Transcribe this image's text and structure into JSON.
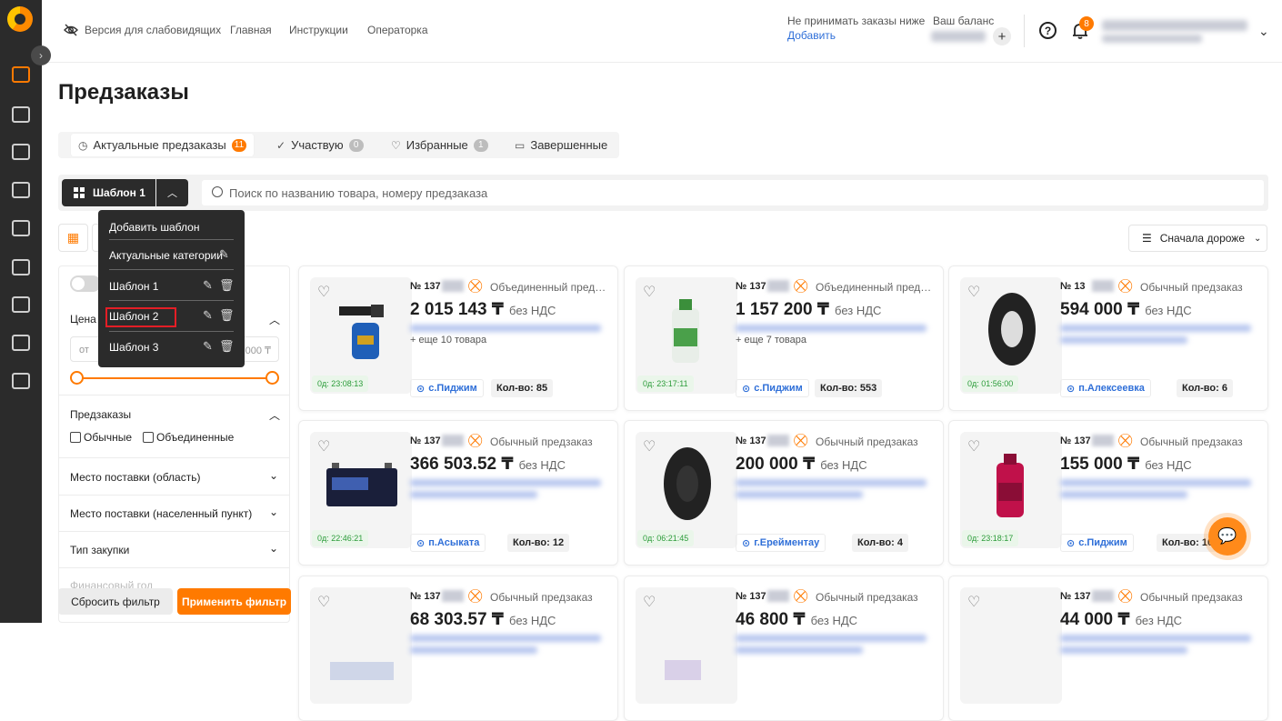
{
  "topbar": {
    "links": [
      "Версия для слабовидящих",
      "Главная",
      "Инструкции",
      "Операторка"
    ],
    "no_orders_label": "Не принимать заказы ниже",
    "add_link": "Добавить",
    "balance_label": "Ваш баланс",
    "notifications_count": "8"
  },
  "page": {
    "title": "Предзаказы"
  },
  "tabs": [
    {
      "label": "Актуальные предзаказы",
      "count": "11"
    },
    {
      "label": "Участвую",
      "count": "0"
    },
    {
      "label": "Избранные",
      "count": "1"
    },
    {
      "label": "Завершенные"
    }
  ],
  "template": {
    "selected": "Шаблон 1"
  },
  "search": {
    "placeholder": "Поиск по названию товара, номеру предзаказа"
  },
  "template_menu": {
    "add": "Добавить шаблон",
    "actual_categories": "Актуальные категории",
    "items": [
      "Шаблон 1",
      "Шаблон 2",
      "Шаблон 3"
    ]
  },
  "sort": {
    "label": "Сначала дороже"
  },
  "filters": {
    "price_label": "Цена",
    "price_from_placeholder": "от",
    "price_to_suffix": "000 ₸",
    "preorders_label": "Предзаказы",
    "option_regular": "Обычные",
    "option_combined": "Объединенные",
    "region_label": "Место поставки (область)",
    "city_label": "Место поставки (населенный пункт)",
    "purchase_type_label": "Тип закупки",
    "fiscal_year_label": "Финансовый год",
    "reset": "Сбросить фильтр",
    "apply": "Применить фильтр"
  },
  "cards": [
    {
      "num": "№ 137",
      "type": "Объединенный предзаказ",
      "price": "2 015 143 ₸",
      "vat": "без НДС",
      "more": "+ еще 10 товара",
      "timer": "0д: 23:08:13",
      "location": "с.Пиджим",
      "qty": "Кол-во: 85"
    },
    {
      "num": "№ 137",
      "type": "Объединенный предзаказ",
      "price": "1 157 200 ₸",
      "vat": "без НДС",
      "more": "+ еще 7 товара",
      "timer": "0д: 23:17:11",
      "location": "с.Пиджим",
      "qty": "Кол-во: 553"
    },
    {
      "num": "№ 13",
      "type": "Обычный предзаказ",
      "price": "594 000 ₸",
      "vat": "без НДС",
      "more": "",
      "timer": "0д: 01:56:00",
      "location": "п.Алексеевка",
      "qty": "Кол-во: 6"
    },
    {
      "num": "№ 137",
      "type": "Обычный предзаказ",
      "price": "366 503.52 ₸",
      "vat": "без НДС",
      "more": "",
      "timer": "0д: 22:46:21",
      "location": "п.Асыката",
      "qty": "Кол-во: 12"
    },
    {
      "num": "№ 137",
      "type": "Обычный предзаказ",
      "price": "200 000 ₸",
      "vat": "без НДС",
      "more": "",
      "timer": "0д: 06:21:45",
      "location": "г.Ерейментау",
      "qty": "Кол-во: 4"
    },
    {
      "num": "№ 137",
      "type": "Обычный предзаказ",
      "price": "155 000 ₸",
      "vat": "без НДС",
      "more": "",
      "timer": "0д: 23:18:17",
      "location": "с.Пиджим",
      "qty": "Кол-во: 10"
    },
    {
      "num": "№ 137",
      "type": "Обычный предзаказ",
      "price": "68 303.57 ₸",
      "vat": "без НДС",
      "more": "",
      "timer": "",
      "location": "",
      "qty": ""
    },
    {
      "num": "№ 137",
      "type": "Обычный предзаказ",
      "price": "46 800 ₸",
      "vat": "без НДС",
      "more": "",
      "timer": "",
      "location": "",
      "qty": ""
    },
    {
      "num": "№ 137",
      "type": "Обычный предзаказ",
      "price": "44 000 ₸",
      "vat": "без НДС",
      "more": "",
      "timer": "",
      "location": "",
      "qty": ""
    }
  ],
  "colors": {
    "accent": "#ff7a00",
    "sidebar": "#2b2b2b",
    "link": "#2f6fd8",
    "highlight": "#e41e26"
  }
}
